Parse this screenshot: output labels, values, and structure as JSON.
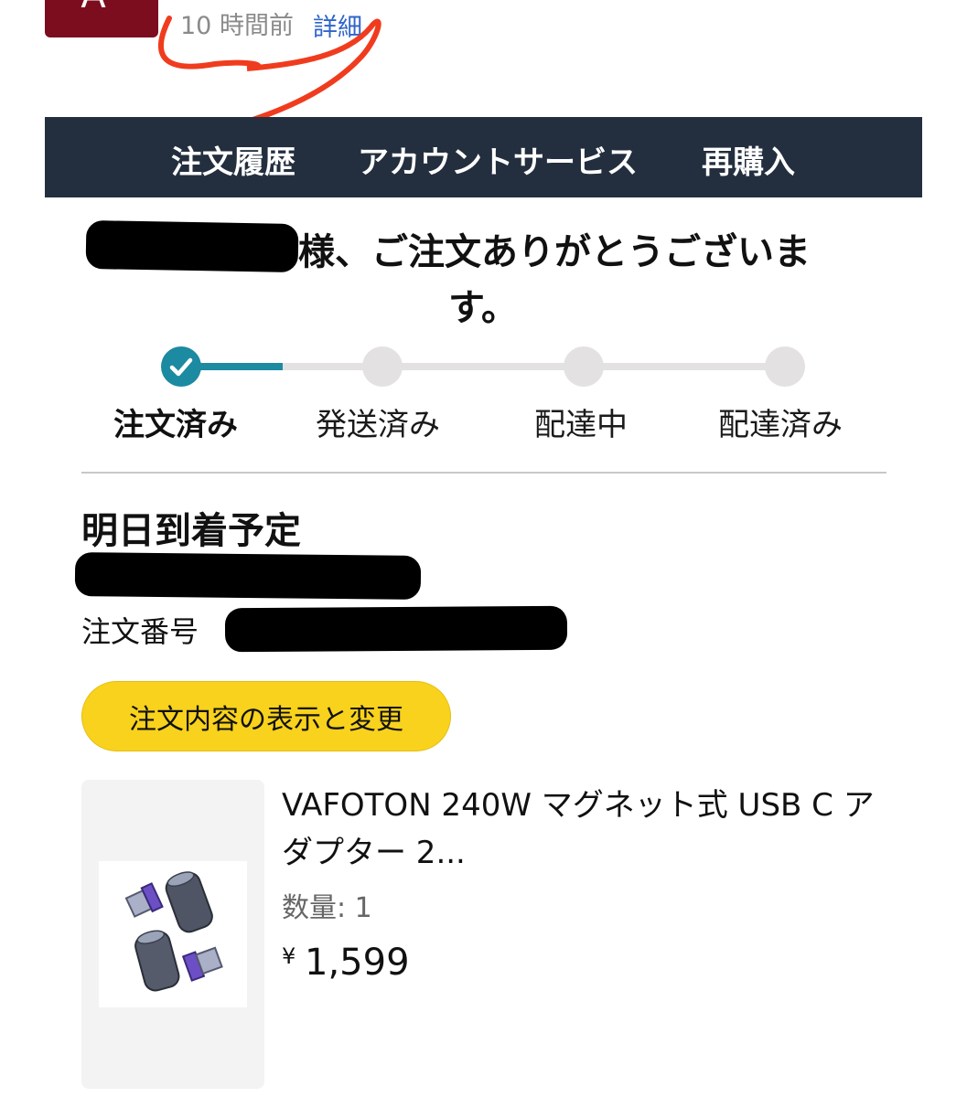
{
  "header": {
    "avatar_letter": "A",
    "time_ago": "10 時間前",
    "detail_link": "詳細"
  },
  "nav": {
    "items": [
      "注文履歴",
      "アカウントサービス",
      "再購入"
    ],
    "background": "#232f3e"
  },
  "greeting": {
    "line1": "様、ご注文ありがとうございま",
    "line2": "す。"
  },
  "progress": {
    "steps": [
      "注文済み",
      "発送済み",
      "配達中",
      "配達済み"
    ],
    "current_step": 1,
    "accent_color": "#1c8aa0"
  },
  "delivery": {
    "arrival_text": "明日到着予定",
    "order_number_label": "注文番号"
  },
  "actions": {
    "view_change_button": "注文内容の表示と変更",
    "button_color": "#f8d21c"
  },
  "product": {
    "title": "VAFOTON 240W マグネット式 USB C アダプター 2...",
    "quantity_label": "数量: 1",
    "price_symbol": "¥",
    "price": "1,599"
  }
}
